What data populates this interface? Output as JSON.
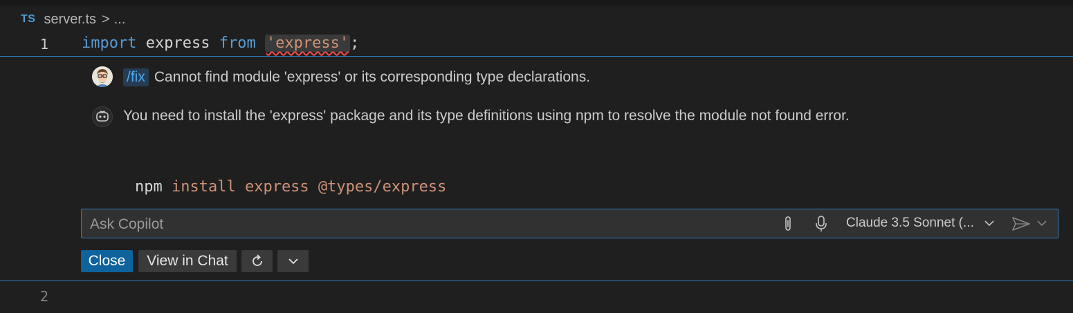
{
  "breadcrumb": {
    "lang_badge": "TS",
    "file": "server.ts",
    "separator": ">",
    "more": "..."
  },
  "editor": {
    "line1_number": "1",
    "line2_number": "2",
    "line1_tokens": {
      "import_kw": "import",
      "ident": "express",
      "from_kw": "from",
      "module_str": "'express'",
      "semicolon": ";"
    }
  },
  "chat": {
    "user_command": "/fix",
    "user_message": "Cannot find module 'express' or its corresponding type declarations.",
    "bot_message": "You need to install the 'express' package and its type definitions using npm to resolve the module not found error.",
    "code_cmd": "npm",
    "code_args": "install express @types/express"
  },
  "input": {
    "placeholder": "Ask Copilot",
    "model": "Claude 3.5 Sonnet (..."
  },
  "actions": {
    "close": "Close",
    "view_in_chat": "View in Chat"
  },
  "icons": {
    "attach": "paperclip-icon",
    "mic": "microphone-icon",
    "send": "send-icon",
    "regenerate": "refresh-icon",
    "more": "chevron-down-icon",
    "bot": "copilot-icon"
  },
  "colors": {
    "accent": "#2f7fc4",
    "primary_button": "#0e639c",
    "keyword": "#569cd6",
    "string": "#ce9178",
    "error_squiggle": "#f14c4c"
  }
}
